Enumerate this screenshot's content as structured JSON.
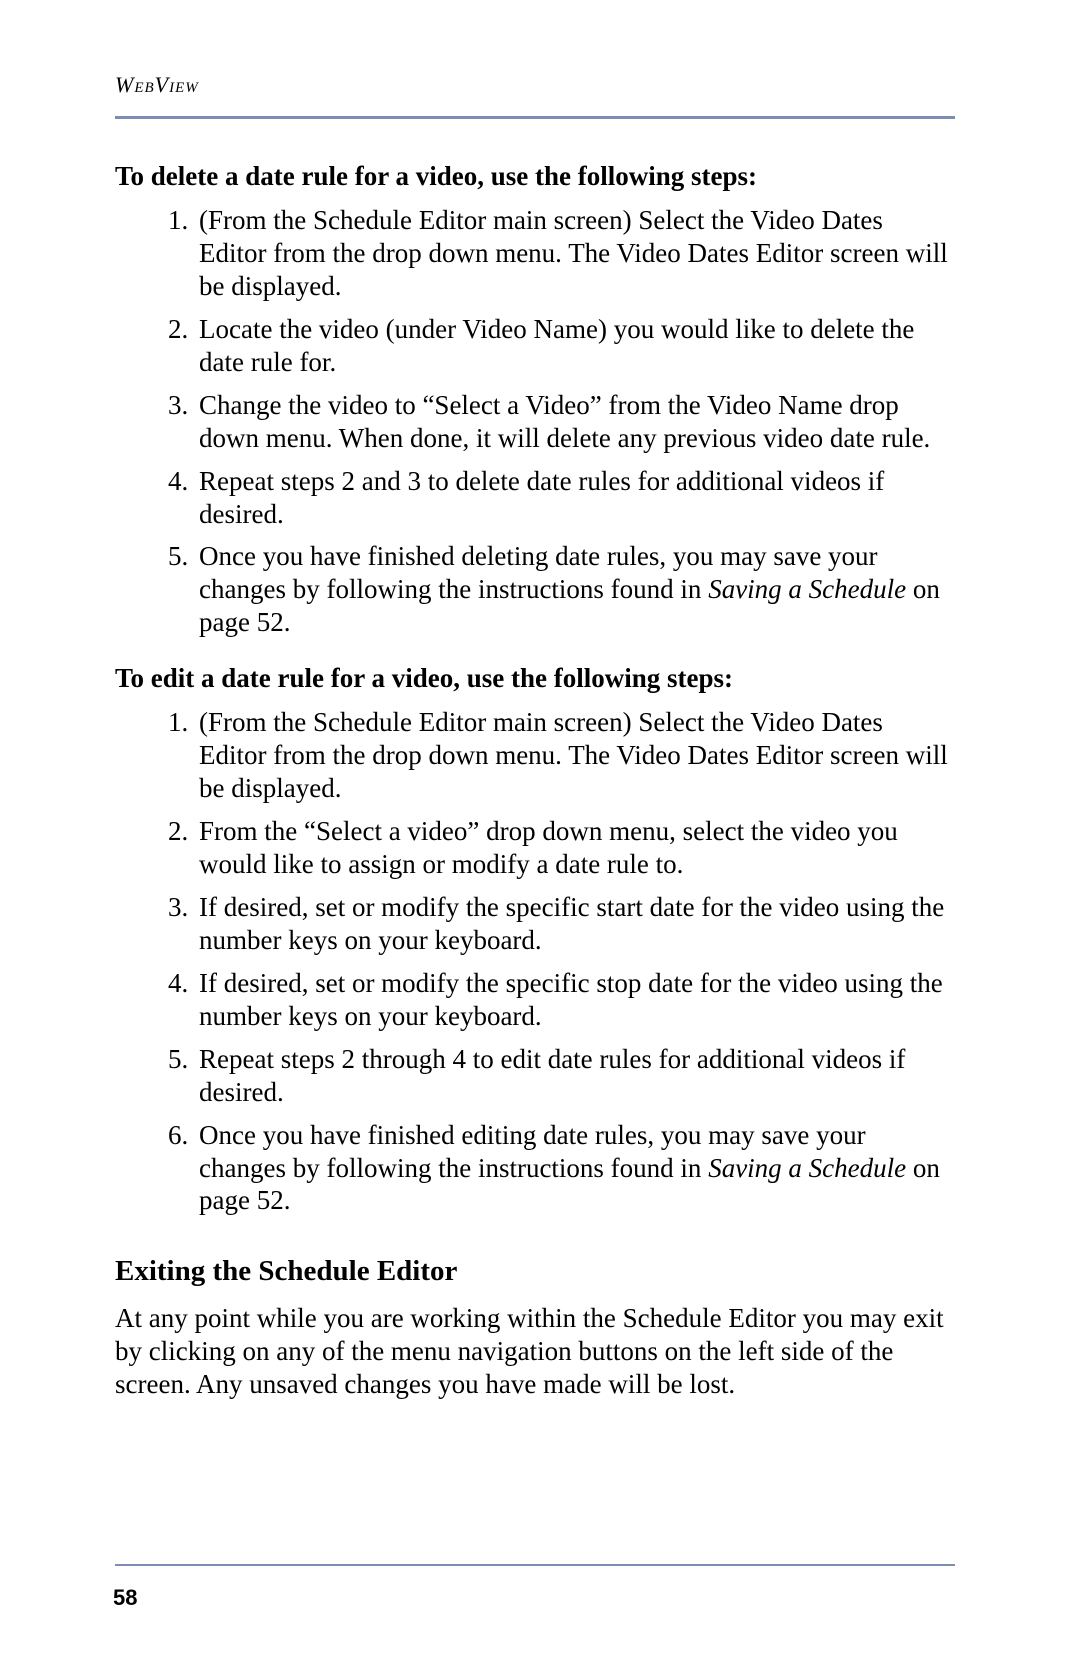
{
  "header": {
    "running_head": "WebView"
  },
  "section1": {
    "lead": "To delete a date rule for a video, use the following steps:",
    "steps": [
      "(From the Schedule Editor main screen) Select the Video Dates Editor from the drop down menu. The Video Dates Editor screen will be displayed.",
      "Locate the video (under Video Name) you would like to delete the date rule for.",
      "Change the video to “Select a Video” from the Video Name drop down menu. When done, it will delete any previous video date rule.",
      "Repeat steps 2 and 3 to delete date rules for additional videos if desired."
    ],
    "final_step": {
      "pre": "Once you have finished deleting date rules, you may save your changes by following the instructions found in ",
      "ital": "Saving a Schedule",
      "post": " on page 52."
    }
  },
  "section2": {
    "lead": "To edit a date rule for a video, use the following steps:",
    "steps": [
      "(From the Schedule Editor main screen) Select the Video Dates Editor from the drop down menu. The Video Dates Editor screen will be displayed.",
      "From the “Select a video” drop down menu, select the video you would like to assign or modify a date rule to.",
      "If desired, set or modify the specific start date for the video using the number keys on your keyboard.",
      "If desired, set or modify the specific stop date for the video using the number keys on your keyboard.",
      "Repeat steps 2 through 4 to edit date rules for additional videos if desired."
    ],
    "final_step": {
      "pre": "Once you have finished editing date rules, you may save your changes by following the instructions found in ",
      "ital": "Saving a Schedule",
      "post": " on page 52."
    }
  },
  "section3": {
    "heading": "Exiting the Schedule Editor",
    "body": "At any point while you are working within the Schedule Editor you may exit by clicking on any of the menu navigation buttons on the left side of the screen. Any unsaved changes you have made will be lost."
  },
  "page_number": "58"
}
